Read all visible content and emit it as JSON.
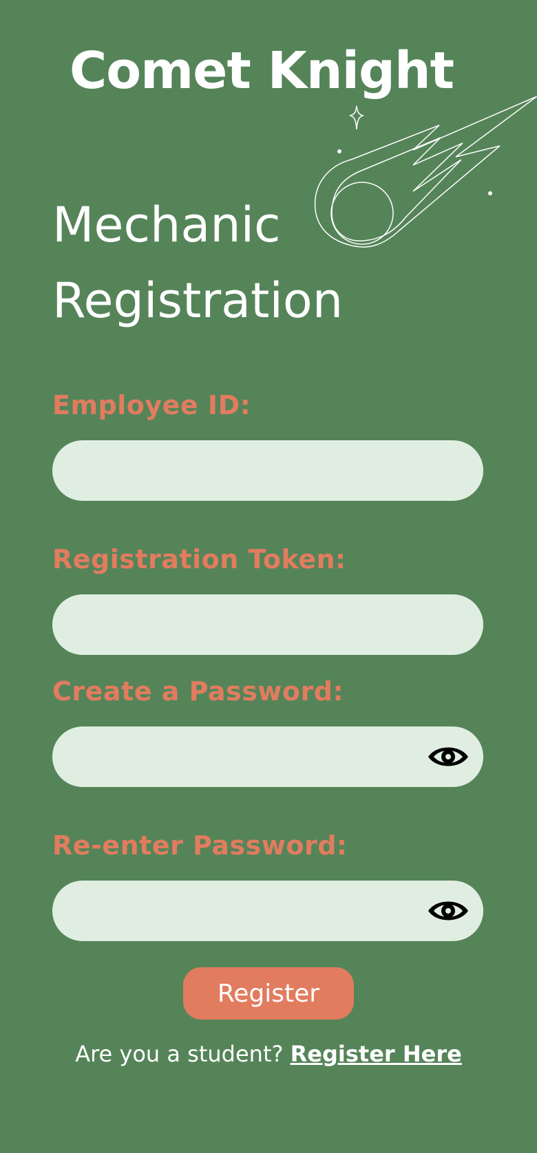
{
  "header": {
    "app_title": "Comet Knight"
  },
  "page": {
    "title_line1": "Mechanic",
    "title_line2": "Registration"
  },
  "form": {
    "employee_id_label": "Employee ID:",
    "employee_id_value": "",
    "token_label": "Registration Token:",
    "token_value": "",
    "password_label": "Create a Password:",
    "password_value": "",
    "reenter_label": "Re-enter Password:",
    "reenter_value": "",
    "register_label": "Register"
  },
  "footer": {
    "prompt": "Are you a student?",
    "link": "Register Here"
  },
  "icons": {
    "decoration": "comet-icon",
    "show_password": "eye-icon"
  },
  "colors": {
    "background": "#558459",
    "accent": "#e27c5f",
    "field": "#e0eee2",
    "text": "#ffffff"
  }
}
